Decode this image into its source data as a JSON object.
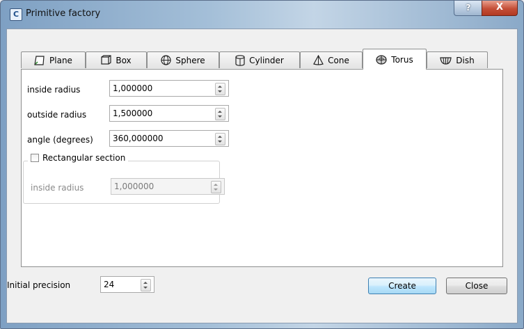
{
  "window": {
    "title": "Primitive factory",
    "app_icon_glyph": "C",
    "help_label": "?",
    "close_label": "X"
  },
  "tabs": [
    {
      "label": "Plane",
      "icon": "plane-icon",
      "active": false
    },
    {
      "label": "Box",
      "icon": "box-icon",
      "active": false
    },
    {
      "label": "Sphere",
      "icon": "sphere-icon",
      "active": false
    },
    {
      "label": "Cylinder",
      "icon": "cylinder-icon",
      "active": false
    },
    {
      "label": "Cone",
      "icon": "cone-icon",
      "active": false
    },
    {
      "label": "Torus",
      "icon": "torus-icon",
      "active": true
    },
    {
      "label": "Dish",
      "icon": "dish-icon",
      "active": false
    }
  ],
  "torus": {
    "inside_radius": {
      "label": "inside radius",
      "value": "1,000000"
    },
    "outside_radius": {
      "label": "outside radius",
      "value": "1,500000"
    },
    "angle": {
      "label": "angle (degrees)",
      "value": "360,000000"
    },
    "rect_section": {
      "label": "Rectangular section",
      "checked": false,
      "inside_radius": {
        "label": "inside radius",
        "value": "1,000000"
      }
    }
  },
  "footer": {
    "precision_label": "Initial precision",
    "precision_value": "24",
    "create_label": "Create",
    "close_label": "Close"
  },
  "colors": {
    "default_button": "#3c7fb1",
    "window_close": "#c44e37"
  }
}
